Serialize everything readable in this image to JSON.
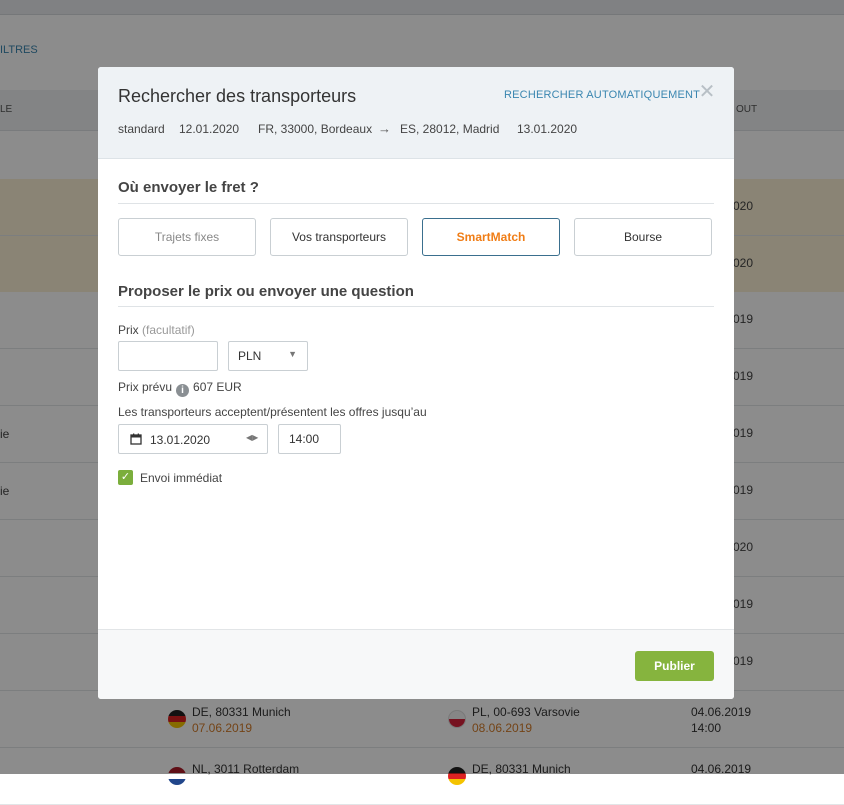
{
  "background": {
    "filter_link": "ILTRES",
    "header_left": "LE",
    "header_right": "OUT",
    "rows": [
      {
        "left": "",
        "right": "020"
      },
      {
        "left": "",
        "right": "020"
      },
      {
        "left": "",
        "right": "019"
      },
      {
        "left": "",
        "right": "019"
      },
      {
        "left": "ie",
        "right": "019"
      },
      {
        "left": "ie",
        "right": "019"
      },
      {
        "left": "",
        "right": "020"
      },
      {
        "left": "",
        "right": "019"
      },
      {
        "left": "",
        "right": "019"
      }
    ],
    "row_a": {
      "from_place": "DE, 80331 Munich",
      "from_date": "07.06.2019",
      "to_place": "PL, 00-693 Varsovie",
      "to_date": "08.06.2019",
      "date": "04.06.2019",
      "time": "14:00"
    },
    "row_b": {
      "from_place": "NL, 3011 Rotterdam",
      "to_place": "DE, 80331 Munich",
      "date": "04.06.2019"
    }
  },
  "modal": {
    "title": "Rechercher des transporteurs",
    "auto_search": "RECHERCHER AUTOMATIQUEMENT",
    "close": "✕",
    "meta": {
      "type": "standard",
      "load_date": "12.01.2020",
      "from": "FR, 33000, Bordeaux",
      "arrow": "→",
      "to": "ES, 28012, Madrid",
      "unload_date": "13.01.2020"
    },
    "section1_title": "Où envoyer le fret ?",
    "options": [
      "Trajets fixes",
      "Vos transporteurs",
      "SmartMatch",
      "Bourse"
    ],
    "section2_title": "Proposer le prix ou envoyer une question",
    "price_label": "Prix",
    "price_optional": "(facultatif)",
    "price_value": "",
    "currency": "PLN",
    "expected_price_label": "Prix prévu",
    "expected_price_value": "607 EUR",
    "deadline_label": "Les transporteurs acceptent/présentent les offres jusqu’au",
    "deadline_date": "13.01.2020",
    "deadline_time": "14:00",
    "immediate_label": "Envoi immédiat",
    "publish_button": "Publier"
  },
  "colors": {
    "accent_orange": "#f07d16",
    "publish_green": "#86b43e",
    "link_blue": "#3a86b0"
  }
}
